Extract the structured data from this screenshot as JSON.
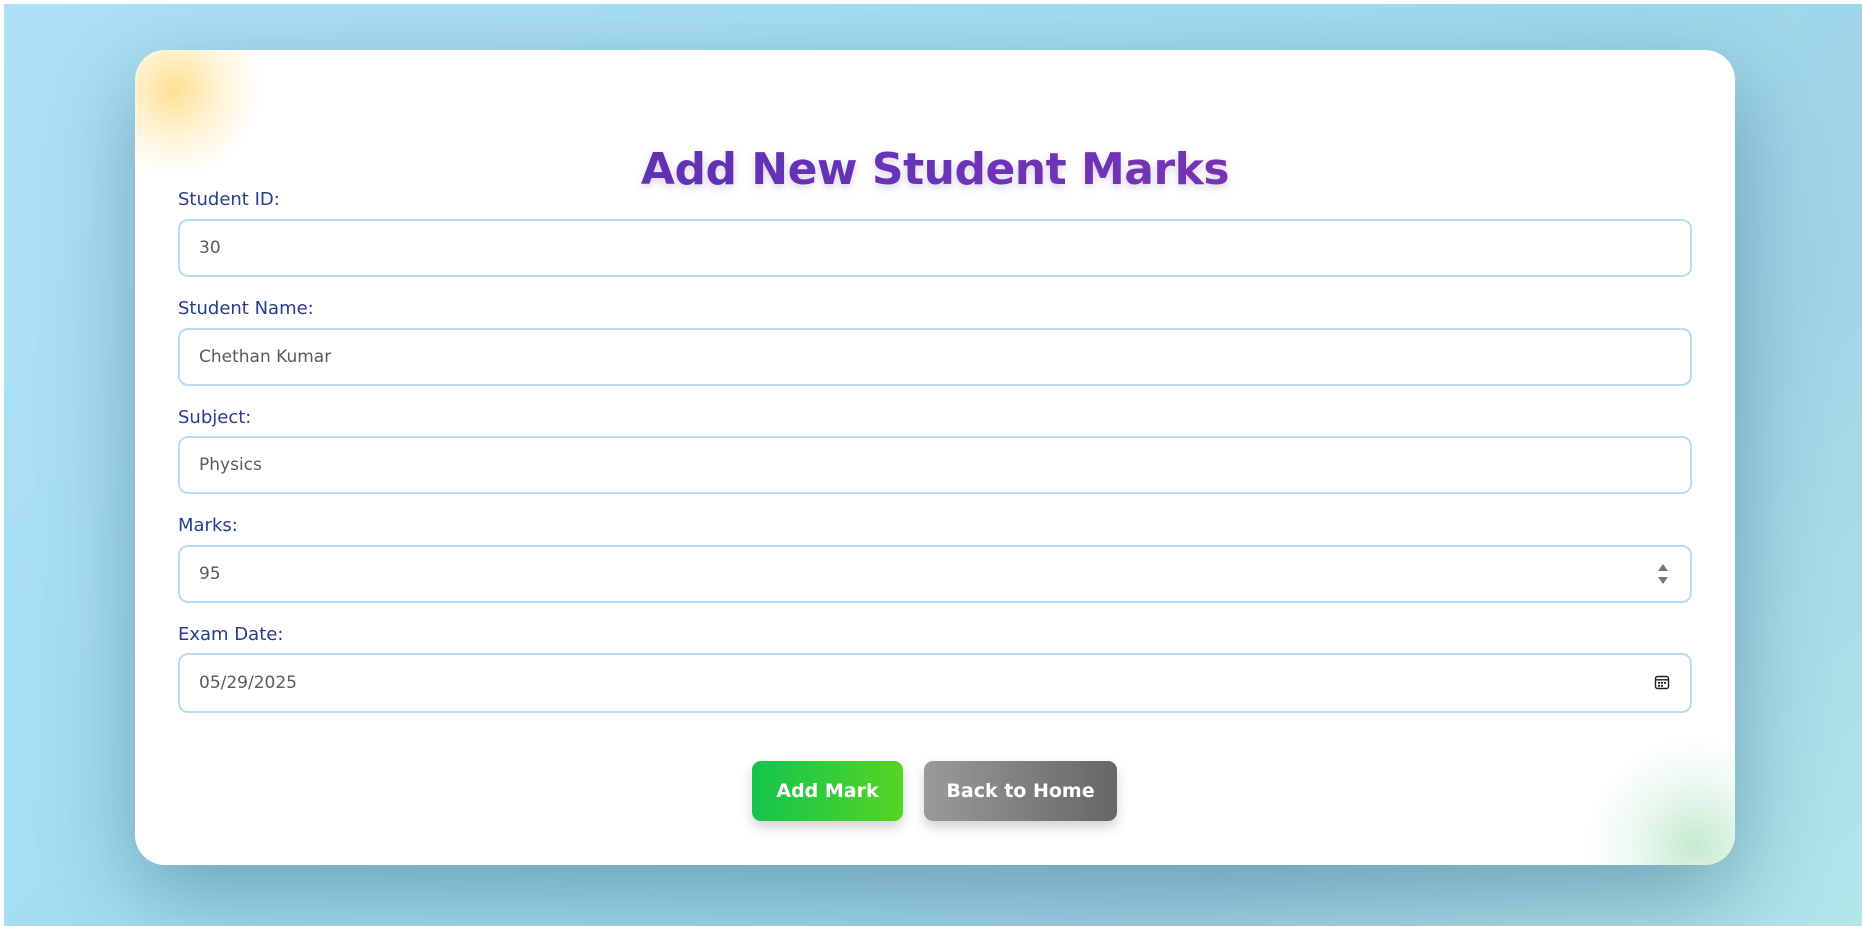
{
  "form": {
    "title": "Add New Student Marks",
    "fields": [
      {
        "label": "Student ID:",
        "value": "30"
      },
      {
        "label": "Student Name:",
        "value": "Chethan Kumar"
      },
      {
        "label": "Subject:",
        "value": "Physics"
      },
      {
        "label": "Marks:",
        "value": "95"
      },
      {
        "label": "Exam Date:",
        "value": "05/29/2025"
      }
    ]
  },
  "actions": {
    "add_label": "Add Mark",
    "back_label": "Back to Home"
  },
  "icons": {
    "marks_spinner": "spinner-arrows-icon",
    "exam_date_picker": "calendar-icon"
  },
  "colors": {
    "title_gradient_start": "#4a2fb0",
    "title_gradient_end": "#8a33b0",
    "label": "#283c8c",
    "field_border": "#b9dcf2",
    "add_button_start": "#14c44e",
    "add_button_end": "#55d424",
    "back_button_start": "#9a9a9a",
    "back_button_end": "#666666",
    "background": "#aee1f7"
  }
}
